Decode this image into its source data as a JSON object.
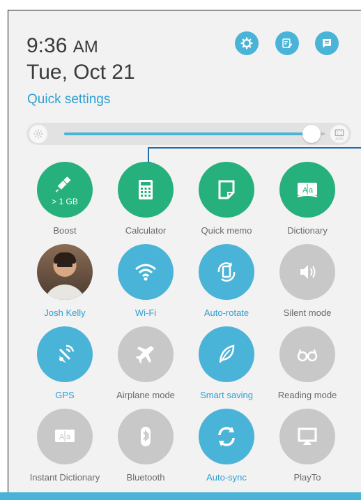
{
  "header": {
    "time": "9:36",
    "ampm": "AM",
    "date": "Tue, Oct 21",
    "quick_settings_link": "Quick settings",
    "buttons": [
      {
        "name": "settings",
        "icon": "gear-icon"
      },
      {
        "name": "edit",
        "icon": "edit-note-icon"
      },
      {
        "name": "notifications",
        "icon": "message-list-icon"
      }
    ]
  },
  "brightness": {
    "level_fraction": 0.95,
    "auto_label": "AUTO",
    "low_icon": "brightness-icon",
    "auto_icon": "auto-brightness-icon"
  },
  "colors": {
    "green_active": "#26b07c",
    "blue_active": "#4ab3d8",
    "inactive": "#c8c8c8",
    "label_active": "#2f9fd2"
  },
  "tiles": [
    {
      "label": "Boost",
      "sub": "> 1 GB",
      "icon": "broom-icon",
      "state": "green"
    },
    {
      "label": "Calculator",
      "icon": "calculator-icon",
      "state": "green"
    },
    {
      "label": "Quick memo",
      "icon": "memo-icon",
      "state": "green"
    },
    {
      "label": "Dictionary",
      "icon": "dictionary-icon",
      "state": "green"
    },
    {
      "label": "Josh Kelly",
      "icon": "contact-avatar",
      "state": "avatar"
    },
    {
      "label": "Wi-Fi",
      "icon": "wifi-icon",
      "state": "blue"
    },
    {
      "label": "Auto-rotate",
      "icon": "rotate-icon",
      "state": "blue"
    },
    {
      "label": "Silent mode",
      "icon": "speaker-icon",
      "state": "off"
    },
    {
      "label": "GPS",
      "icon": "gps-icon",
      "state": "blue"
    },
    {
      "label": "Airplane mode",
      "icon": "airplane-icon",
      "state": "off"
    },
    {
      "label": "Smart saving",
      "icon": "leaf-icon",
      "state": "blue"
    },
    {
      "label": "Reading mode",
      "icon": "glasses-icon",
      "state": "off"
    },
    {
      "label": "Instant Dictionary",
      "icon": "instant-dictionary-icon",
      "state": "off"
    },
    {
      "label": "Bluetooth",
      "icon": "bluetooth-icon",
      "state": "off"
    },
    {
      "label": "Auto-sync",
      "icon": "sync-icon",
      "state": "blue"
    },
    {
      "label": "PlayTo",
      "icon": "cast-icon",
      "state": "off"
    }
  ]
}
